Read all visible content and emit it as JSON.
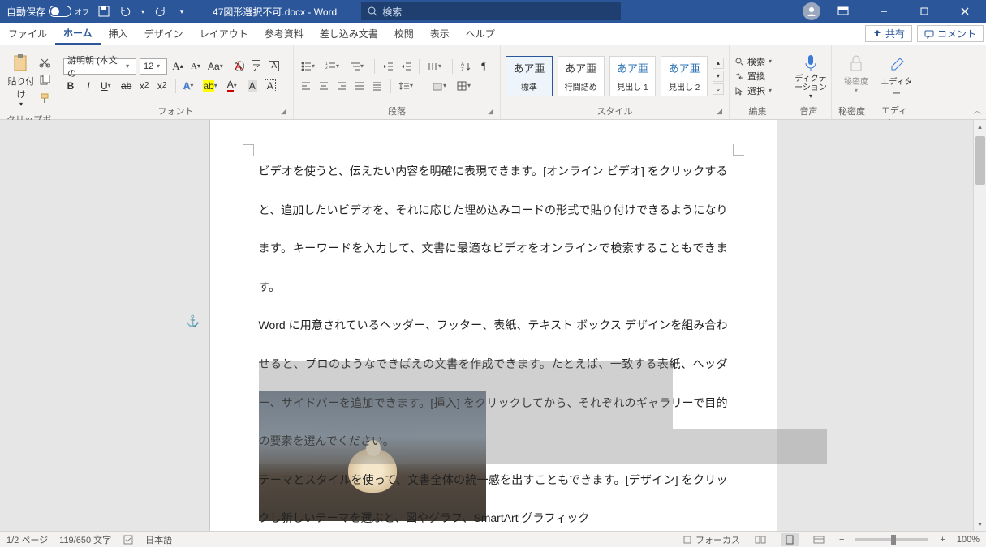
{
  "titlebar": {
    "autosave_label": "自動保存",
    "autosave_state": "オフ",
    "doc_title": "47図形選択不可.docx - Word",
    "search_placeholder": "検索"
  },
  "tabs": {
    "file": "ファイル",
    "home": "ホーム",
    "insert": "挿入",
    "design": "デザイン",
    "layout": "レイアウト",
    "references": "参考資料",
    "mailings": "差し込み文書",
    "review": "校閲",
    "view": "表示",
    "help": "ヘルプ",
    "share": "共有",
    "comment": "コメント"
  },
  "ribbon": {
    "clipboard": {
      "paste": "貼り付け",
      "label": "クリップボード"
    },
    "font": {
      "name": "游明朝 (本文の",
      "size": "12",
      "label": "フォント"
    },
    "paragraph": {
      "label": "段落"
    },
    "styles": {
      "label": "スタイル",
      "preview": "あア亜",
      "items": [
        "標準",
        "行間詰め",
        "見出し 1",
        "見出し 2"
      ]
    },
    "editing": {
      "find": "検索",
      "replace": "置換",
      "select": "選択",
      "label": "編集"
    },
    "dictation": {
      "btn": "ディクテーション",
      "label": "音声"
    },
    "sensitivity": {
      "btn": "秘密度",
      "label": "秘密度"
    },
    "editor": {
      "btn": "エディター",
      "label": "エディター"
    }
  },
  "document": {
    "p1": "ビデオを使うと、伝えたい内容を明確に表現できます。[オンライン ビデオ] をクリックすると、追加したいビデオを、それに応じた埋め込みコードの形式で貼り付けできるようになります。キーワードを入力して、文書に最適なビデオをオンラインで検索することもできます。",
    "p2": "Word に用意されているヘッダー、フッター、表紙、テキスト ボックス デザインを組み合わせると、プロのようなできばえの文書を作成できます。たとえば、一致する表紙、ヘッダー、サイドバーを追加できます。[挿入] をクリックしてから、それぞれのギャラリーで目的の要素を選んでください。",
    "p3": "テーマとスタイルを使って、文書全体の統一感を出すこともできます。[デザイン] をクリックし新しいテーマを選ぶと、図やグラフ、SmartArt グラフィック"
  },
  "statusbar": {
    "page": "1/2 ページ",
    "words": "119/650 文字",
    "lang": "日本語",
    "focus": "フォーカス",
    "zoom": "100%"
  }
}
